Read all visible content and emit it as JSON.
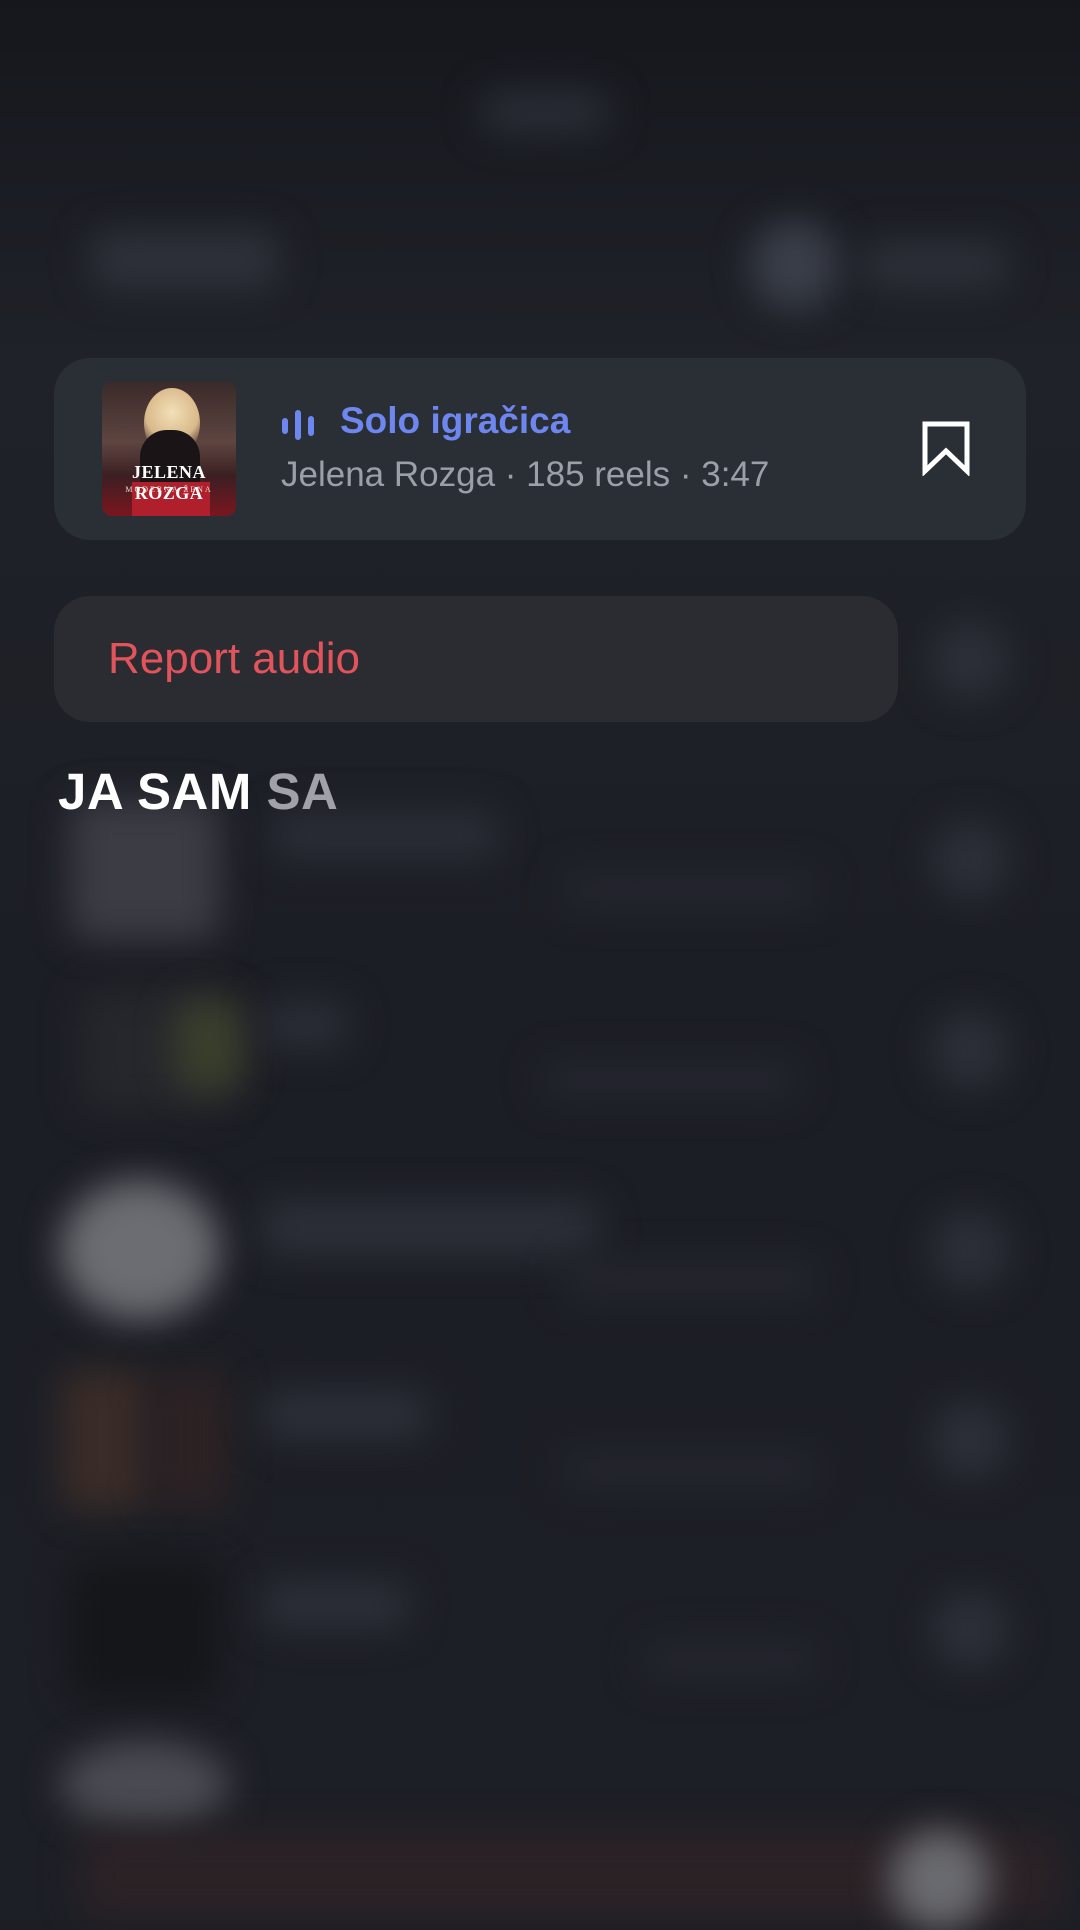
{
  "audio": {
    "cover": {
      "artist_text": "JELENA ROZGA",
      "album_text": "MODERNA ŽENA"
    },
    "title": "Solo igračica",
    "meta": "Jelena Rozga · 185 reels · 3:47",
    "playing_icon": "equalizer-icon",
    "save_icon": "bookmark-icon",
    "title_color": "#6e87f0"
  },
  "actions": {
    "report_label": "Report audio",
    "report_color": "#e2545c"
  },
  "lyrics": {
    "active_text": "JA SAM",
    "upcoming_text": "SA"
  }
}
